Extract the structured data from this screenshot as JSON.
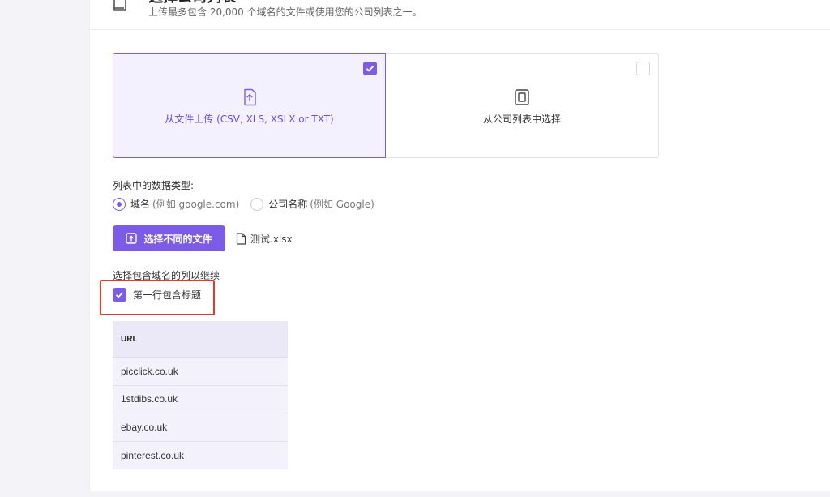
{
  "header": {
    "title": "选择公司列表",
    "subtitle": "上传最多包含 20,000 个域名的文件或使用您的公司列表之一。"
  },
  "source_options": [
    {
      "label": "从文件上传 (CSV, XLS, XSLX or TXT)",
      "icon": "upload-file-icon",
      "selected": true
    },
    {
      "label": "从公司列表中选择",
      "icon": "company-list-icon",
      "selected": false
    }
  ],
  "data_type": {
    "label": "列表中的数据类型:",
    "options": [
      {
        "label": "域名",
        "hint": "(例如 google.com)",
        "selected": true
      },
      {
        "label": "公司名称",
        "hint": "(例如 Google)",
        "selected": false
      }
    ]
  },
  "upload": {
    "button_label": "选择不同的文件",
    "file_name": "测试.xlsx"
  },
  "columns": {
    "label": "选择包含域名的列以继续",
    "header_checkbox_label": "第一行包含标题",
    "header_checkbox_checked": true
  },
  "table": {
    "header": "URL",
    "rows": [
      "picclick.co.uk",
      "1stdibs.co.uk",
      "ebay.co.uk",
      "pinterest.co.uk"
    ]
  },
  "colors": {
    "accent": "#7c5ce6",
    "highlight": "#e8382c"
  }
}
